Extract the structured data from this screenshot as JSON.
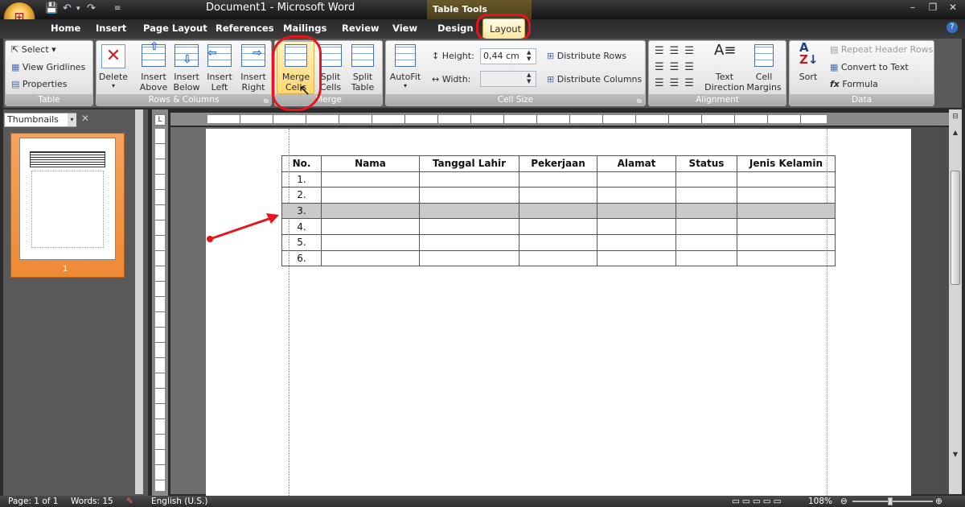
{
  "app": {
    "document_title": "Document1",
    "app_name": "Microsoft Word",
    "title_separator": " - ",
    "contextual_tab_group": "Table Tools"
  },
  "quick_access": {
    "save_icon": "save-icon",
    "undo_icon": "undo-icon",
    "redo_icon": "redo-icon"
  },
  "tabs": [
    "Home",
    "Insert",
    "Page Layout",
    "References",
    "Mailings",
    "Review",
    "View",
    "Design",
    "Layout"
  ],
  "ribbon": {
    "table_group": {
      "label": "Table",
      "select": "Select",
      "view_gridlines": "View Gridlines",
      "properties": "Properties"
    },
    "rows_columns_group": {
      "label": "Rows & Columns",
      "delete": "Delete",
      "insert_above": [
        "Insert",
        "Above"
      ],
      "insert_below": [
        "Insert",
        "Below"
      ],
      "insert_left": [
        "Insert",
        "Left"
      ],
      "insert_right": [
        "Insert",
        "Right"
      ]
    },
    "merge_group": {
      "label": "Merge",
      "merge_cells": [
        "Merge",
        "Cells"
      ],
      "split_cells": [
        "Split",
        "Cells"
      ],
      "split_table": [
        "Split",
        "Table"
      ]
    },
    "cell_size_group": {
      "label": "Cell Size",
      "autofit": "AutoFit",
      "height_label": "Height:",
      "height_value": "0,44 cm",
      "width_label": "Width:",
      "width_value": "",
      "distribute_rows": "Distribute Rows",
      "distribute_columns": "Distribute Columns"
    },
    "alignment_group": {
      "label": "Alignment",
      "text_direction": [
        "Text",
        "Direction"
      ],
      "cell_margins": [
        "Cell",
        "Margins"
      ]
    },
    "data_group": {
      "label": "Data",
      "sort": "Sort",
      "repeat_header_rows": "Repeat Header Rows",
      "convert_to_text": "Convert to Text",
      "formula": "Formula"
    }
  },
  "thumbnails": {
    "dropdown": "Thumbnails",
    "page_number": "1"
  },
  "table": {
    "headers": [
      "No.",
      "Nama",
      "Tanggal Lahir",
      "Pekerjaan",
      "Alamat",
      "Status",
      "Jenis Kelamin"
    ],
    "rows": [
      "1.",
      "2.",
      "3.",
      "4.",
      "5.",
      "6."
    ],
    "selected_row": "3."
  },
  "status_bar": {
    "page": "Page: 1 of 1",
    "words": "Words: 15",
    "language": "English (U.S.)",
    "zoom": "108%"
  },
  "colors": {
    "highlight_circle": "#e8141b",
    "arrow": "#e8141b",
    "active_tab": "#fde69a"
  }
}
